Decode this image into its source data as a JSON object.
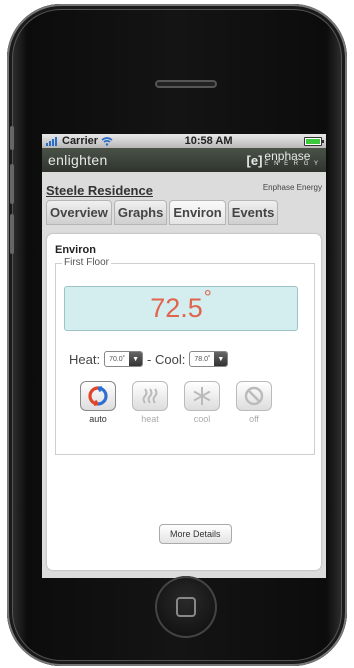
{
  "status": {
    "carrier": "Carrier",
    "time": "10:58 AM"
  },
  "app": {
    "logo_left": "enlighten",
    "logo_right_mark": "[e]",
    "logo_right_name": "enphase",
    "logo_right_sub": "E N E R G Y"
  },
  "site": {
    "name": "Steele Residence",
    "company": "Enphase Energy"
  },
  "tabs": [
    {
      "label": "Overview"
    },
    {
      "label": "Graphs"
    },
    {
      "label": "Environ"
    },
    {
      "label": "Events"
    }
  ],
  "environ": {
    "title": "Environ",
    "zone": "First Floor",
    "temperature": "72.5",
    "degree": "°",
    "heat_label": "Heat:",
    "heat_value": "70.0˚",
    "separator": "- Cool:",
    "cool_value": "78.0˚",
    "modes": [
      {
        "label": "auto",
        "icon": "cycle-icon",
        "active": true
      },
      {
        "label": "heat",
        "icon": "heat-waves-icon",
        "active": false
      },
      {
        "label": "cool",
        "icon": "snowflake-icon",
        "active": false
      },
      {
        "label": "off",
        "icon": "prohibited-icon",
        "active": false
      }
    ],
    "more_details": "More Details"
  },
  "colors": {
    "temp_text": "#e0644e",
    "temp_bg": "#d4eef0",
    "header_bg": "#3b4239"
  }
}
